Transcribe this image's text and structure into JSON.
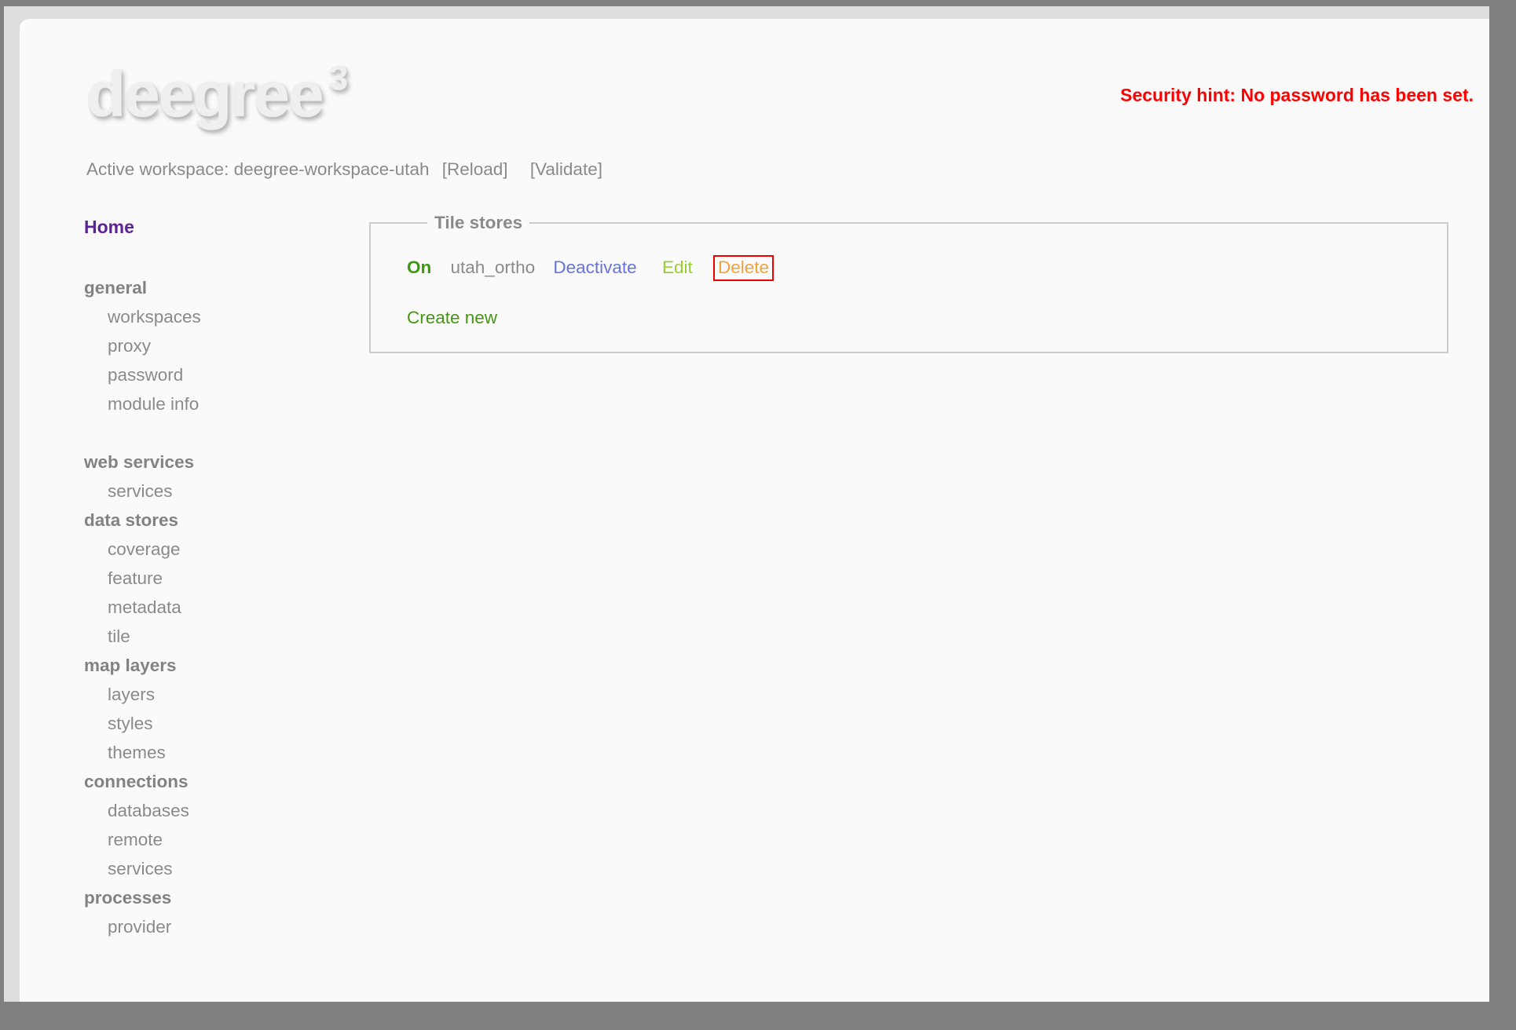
{
  "header": {
    "logo_text": "deegree",
    "logo_sup": "3",
    "security_hint": "Security hint: No password has been set.",
    "workspace_label": "Active workspace: deegree-workspace-utah",
    "reload_link": "[Reload]",
    "validate_link": "[Validate]"
  },
  "sidebar": {
    "home_label": "Home",
    "groups": [
      {
        "label": "general",
        "items": [
          "workspaces",
          "proxy",
          "password",
          "module info"
        ]
      },
      {
        "label": "web services",
        "items": [
          "services"
        ]
      },
      {
        "label": "data stores",
        "items": [
          "coverage",
          "feature",
          "metadata",
          "tile"
        ]
      },
      {
        "label": "map layers",
        "items": [
          "layers",
          "styles",
          "themes"
        ]
      },
      {
        "label": "connections",
        "items": [
          "databases",
          "remote",
          "services"
        ]
      },
      {
        "label": "processes",
        "items": [
          "provider"
        ]
      }
    ]
  },
  "tile_stores": {
    "legend": "Tile stores",
    "row": {
      "status": "On",
      "name": "utah_ortho",
      "deactivate_label": "Deactivate",
      "edit_label": "Edit",
      "delete_label": "Delete"
    },
    "create_new_label": "Create new"
  },
  "colors": {
    "status_on": "#3d9a0f",
    "deactivate_link": "#6674d9",
    "edit_link": "#9acd32",
    "delete_link": "#f2a33a",
    "delete_focus_border": "#ee0000",
    "create_new_link": "#469613",
    "security_hint": "#ff0000",
    "home_link": "#5c2399",
    "page_background": "#fafafa",
    "body_background": "#dedede",
    "frame_background": "#808080",
    "fieldset_border": "#cccccc"
  }
}
